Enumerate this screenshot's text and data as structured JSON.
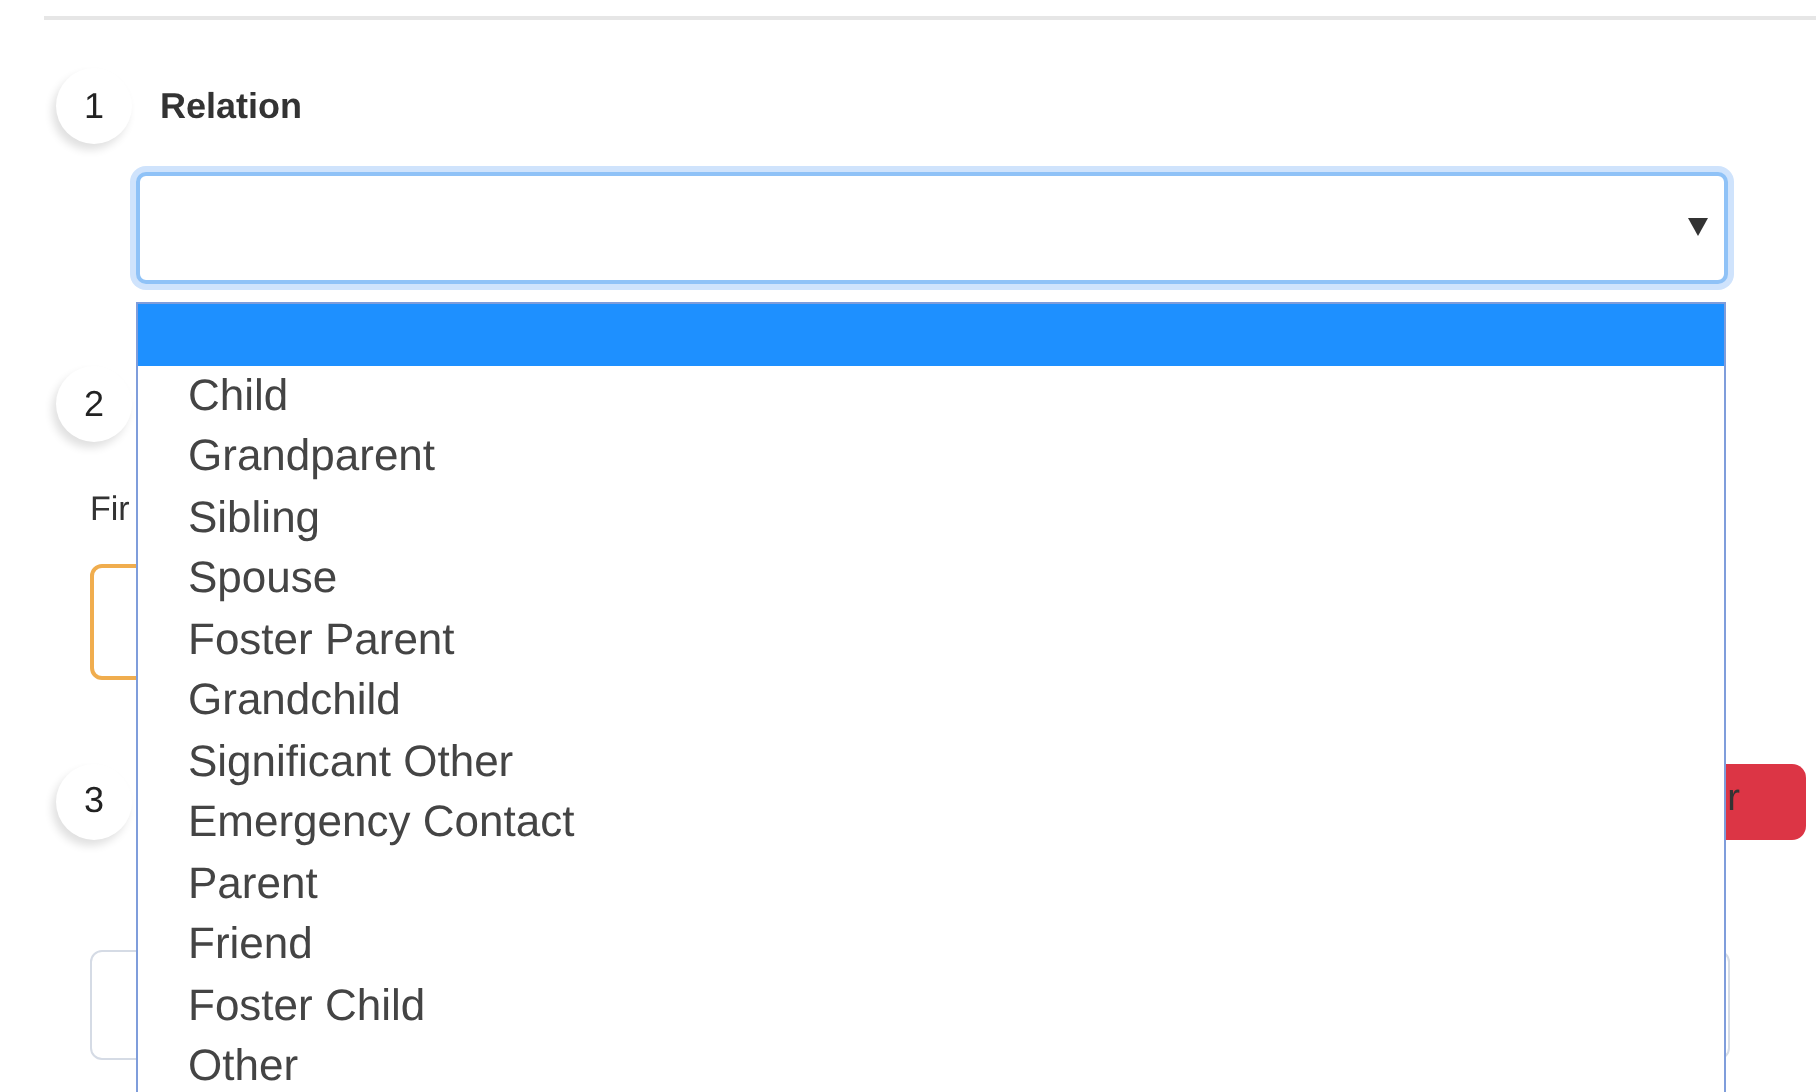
{
  "relation_step": {
    "number": "1",
    "title": "Relation",
    "select": {
      "focused": true,
      "expanded": true,
      "options": [
        {
          "selected": true
        },
        {
          "label": "Child",
          "selected": false
        },
        {
          "label": "Grandparent",
          "selected": false
        },
        {
          "label": "Sibling",
          "selected": false
        },
        {
          "label": "Spouse",
          "selected": false
        },
        {
          "label": "Foster Parent",
          "selected": false
        },
        {
          "label": "Grandchild",
          "selected": false
        },
        {
          "label": "Significant Other",
          "selected": false
        },
        {
          "label": "Emergency Contact",
          "selected": false
        },
        {
          "label": "Parent",
          "selected": false
        },
        {
          "label": "Friend",
          "selected": false
        },
        {
          "label": "Foster Child",
          "selected": false
        },
        {
          "label": "Other",
          "selected": false
        }
      ]
    }
  },
  "step_2": {
    "number": "2",
    "field_label": "Fir"
  },
  "step_3": {
    "number": "3",
    "button": "r"
  }
}
